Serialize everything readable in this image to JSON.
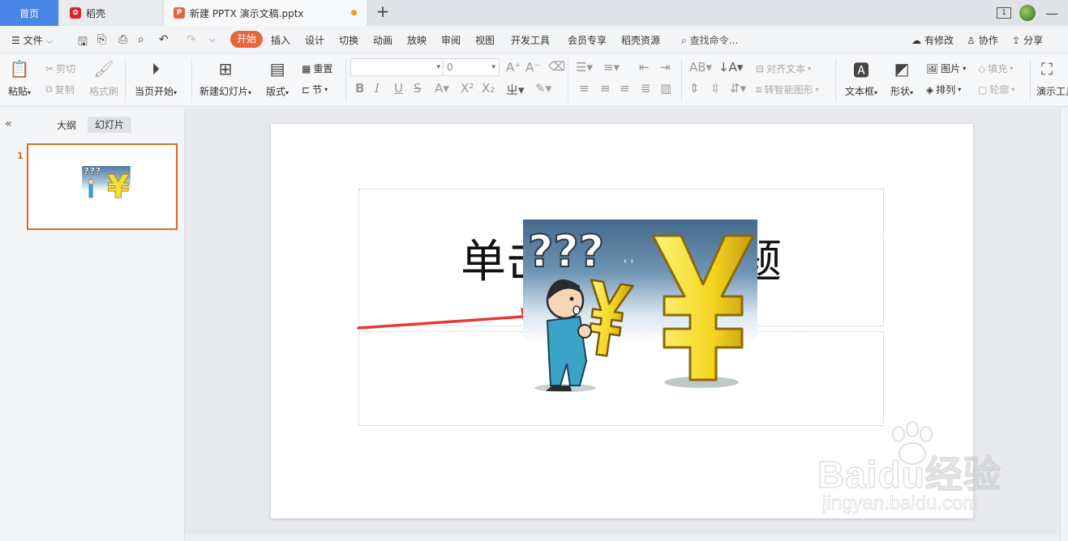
{
  "tabs": {
    "home": "首页",
    "daoke": "稻壳",
    "document": "新建 PPTX 演示文稿.pptx",
    "add": "+"
  },
  "window": {
    "badge": "1",
    "minimize": "—"
  },
  "menu": {
    "file": "文件",
    "items": [
      "开始",
      "插入",
      "设计",
      "切换",
      "动画",
      "放映",
      "审阅",
      "视图",
      "开发工具",
      "会员专享",
      "稻壳资源"
    ],
    "search": "查找命令...",
    "has_changes": "有修改",
    "collaborate": "协作",
    "share": "分享"
  },
  "ribbon": {
    "paste": "粘贴",
    "cut": "剪切",
    "copy": "复制",
    "format_painter": "格式刷",
    "play_from_current": "当页开始",
    "new_slide": "新建幻灯片",
    "layout": "版式",
    "reset": "重置",
    "section": "节",
    "font_size": "0",
    "align_text": "对齐文本",
    "smart_shape": "转智能图形",
    "textbox": "文本框",
    "shape": "形状",
    "picture": "图片",
    "arrange": "排列",
    "fill": "填充",
    "outline": "轮廓",
    "presentation_tools": "演示工具"
  },
  "panel": {
    "outline_tab": "大纲",
    "slides_tab": "幻灯片",
    "slide_number": "1"
  },
  "slide": {
    "title_left": "单击",
    "title_right": "题"
  },
  "watermark": {
    "brand": "Baidu经验",
    "url": "jingyan.baidu.com"
  },
  "colors": {
    "accent": "#e8663d",
    "home_tab": "#4a86e8",
    "selection": "#d9692e",
    "arrow": "#e53935"
  }
}
